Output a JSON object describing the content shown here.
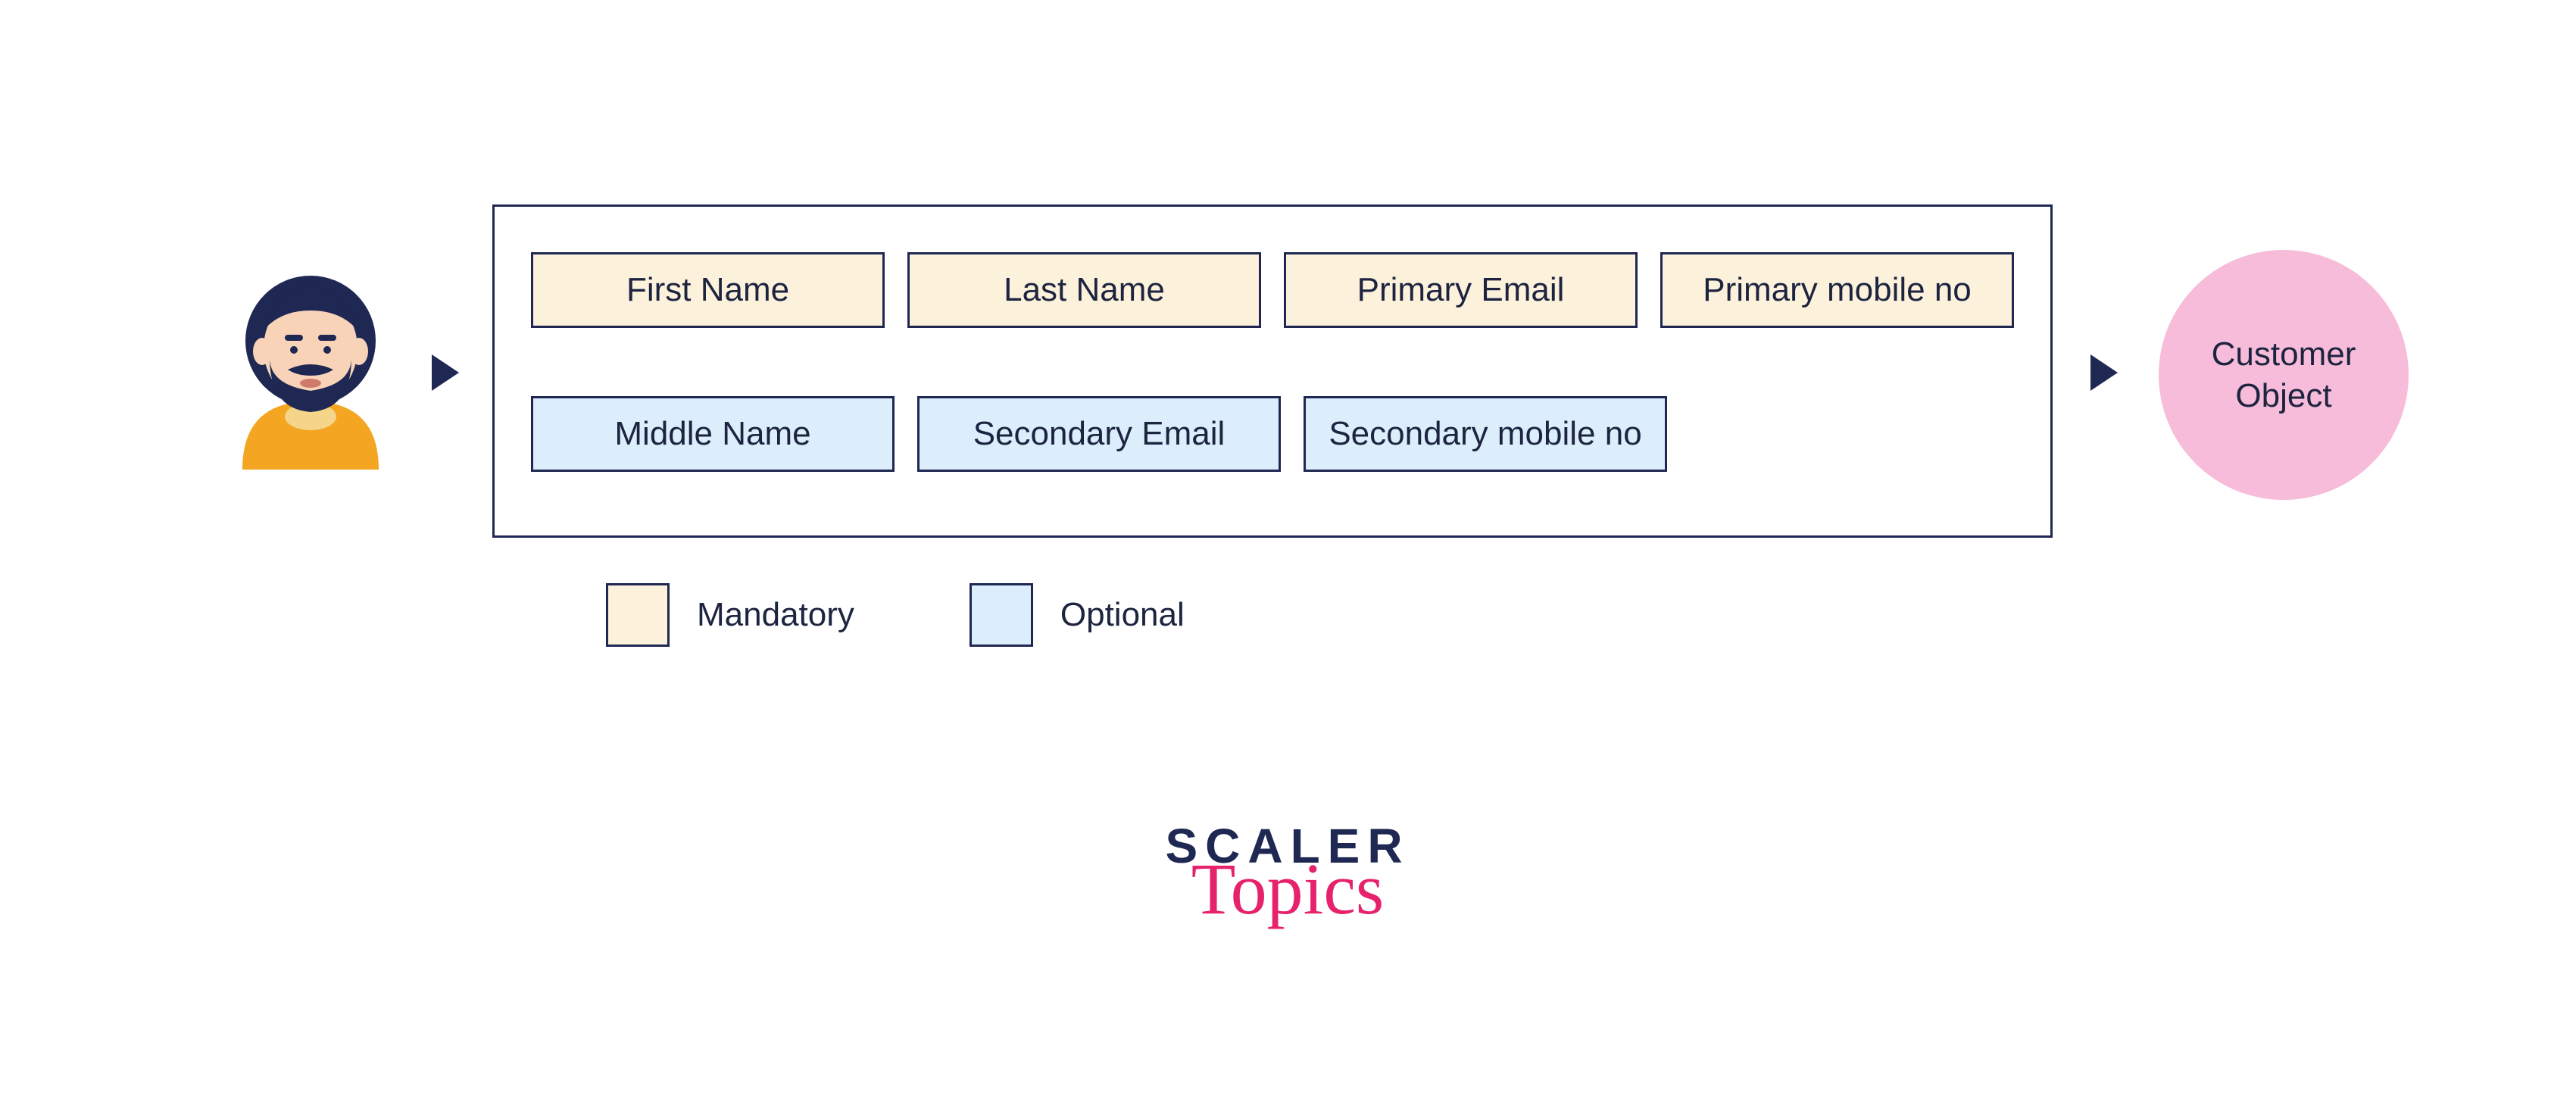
{
  "fields": {
    "mandatory": [
      "First Name",
      "Last Name",
      "Primary Email",
      "Primary mobile no"
    ],
    "optional": [
      "Middle Name",
      "Secondary Email",
      "Secondary mobile no"
    ]
  },
  "legend": {
    "mandatory_label": "Mandatory",
    "optional_label": "Optional"
  },
  "output": {
    "label": "Customer Object"
  },
  "brand": {
    "line1": "SCALER",
    "line2": "Topics"
  },
  "colors": {
    "mandatory_bg": "#fcf1db",
    "optional_bg": "#dceefb",
    "border": "#1f2753",
    "circle_bg": "#f7bcd9",
    "accent": "#e6226d"
  }
}
